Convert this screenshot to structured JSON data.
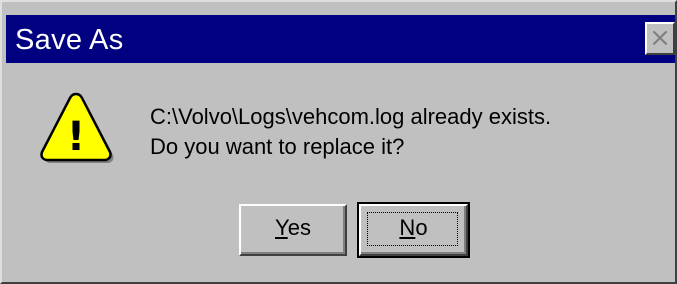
{
  "window": {
    "title": "Save As",
    "close_glyph": "×"
  },
  "icon": {
    "name": "warning-icon",
    "glyph": "!",
    "fill_color": "#ffff00"
  },
  "message": {
    "line1": "C:\\Volvo\\Logs\\vehcom.log already exists.",
    "line2": "Do you want to replace it?"
  },
  "buttons": {
    "yes": {
      "mnemonic": "Y",
      "rest": "es"
    },
    "no": {
      "mnemonic": "N",
      "rest": "o"
    }
  },
  "colors": {
    "titlebar": "#000080",
    "face": "#c0c0c0"
  }
}
